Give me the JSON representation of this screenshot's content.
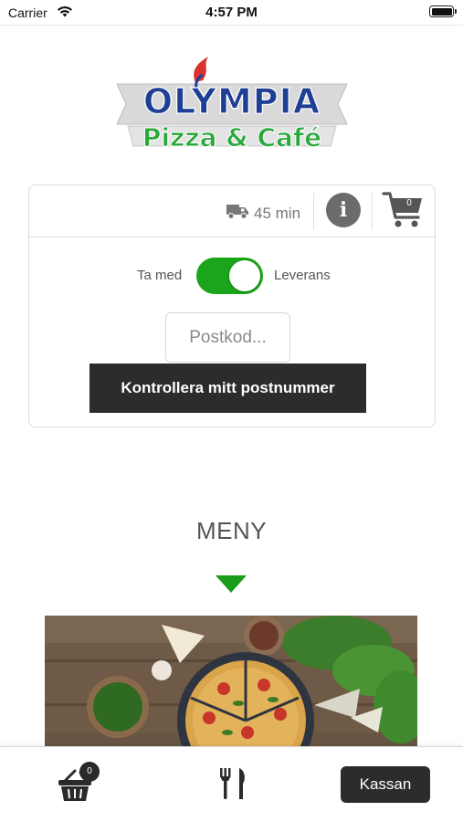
{
  "status_bar": {
    "carrier": "Carrier",
    "time": "4:57 PM"
  },
  "logo": {
    "line1": "OLYMPIA",
    "line2": "Pizza & Café"
  },
  "order": {
    "delivery_time": "45 min",
    "cart_count": "0",
    "toggle_left": "Ta med",
    "toggle_right": "Leverans",
    "toggle_on": true,
    "postcode_placeholder": "Postkod...",
    "check_button": "Kontrollera mitt postnummer"
  },
  "menu": {
    "title": "MENY"
  },
  "bottom_bar": {
    "basket_count": "0",
    "checkout_label": "Kassan"
  },
  "colors": {
    "accent_green": "#1aa51a",
    "dark_button": "#2c2c2c",
    "logo_blue": "#1f3f94",
    "logo_green": "#2aa83a"
  }
}
